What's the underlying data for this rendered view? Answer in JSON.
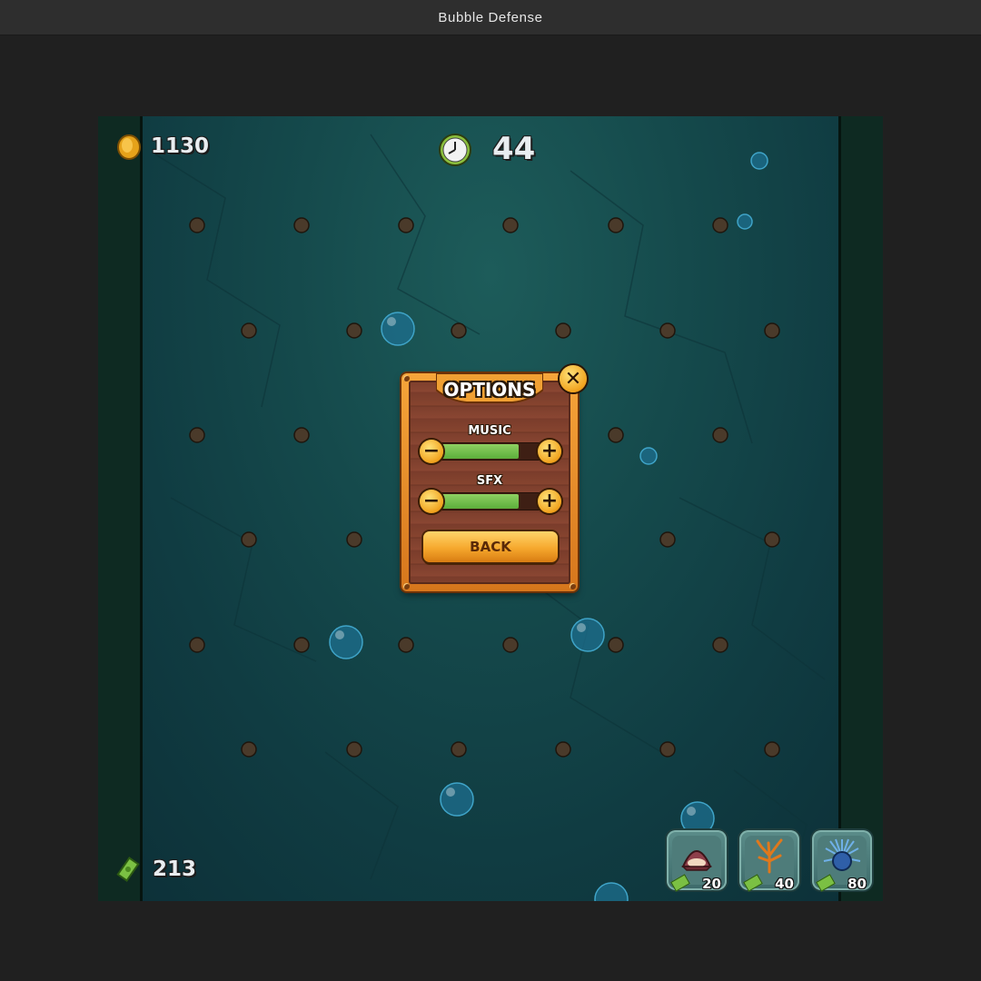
{
  "window": {
    "title": "Bubble Defense"
  },
  "hud": {
    "coins": "1130",
    "timer": "44",
    "cash": "213"
  },
  "options_dialog": {
    "title": "OPTIONS",
    "music_label": "MUSIC",
    "sfx_label": "SFX",
    "music_level": 0.77,
    "sfx_level": 0.77,
    "back_label": "BACK"
  },
  "shop": [
    {
      "name": "clam",
      "price": "20"
    },
    {
      "name": "coral",
      "price": "40"
    },
    {
      "name": "sea-urchin",
      "price": "80"
    }
  ],
  "colors": {
    "water": "#154a4c",
    "panel_orange": "#f6a53a",
    "slider_green": "#6fbd4a"
  }
}
